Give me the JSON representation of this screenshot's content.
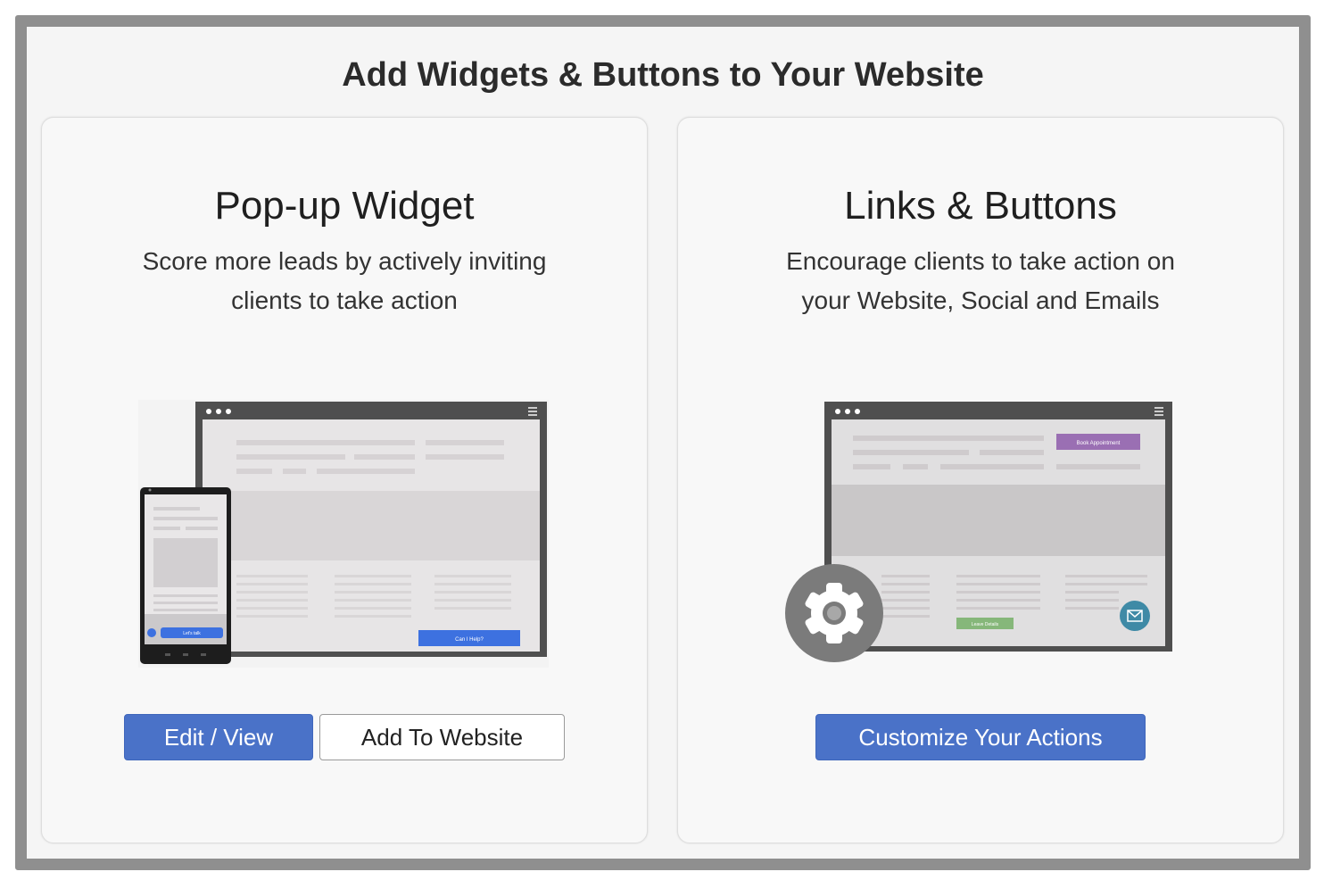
{
  "page": {
    "title": "Add Widgets & Buttons to Your Website"
  },
  "cards": [
    {
      "title": "Pop-up Widget",
      "description_lines": [
        "Score more leads by actively inviting",
        "clients to take action"
      ],
      "buttons": {
        "primary": "Edit / View",
        "secondary": "Add To Website"
      },
      "illustration": {
        "popup_button": "Can I Help?",
        "phone_button": "Let's talk"
      }
    },
    {
      "title": "Links & Buttons",
      "description_lines": [
        "Encourage clients to take action on",
        "your Website, Social and Emails"
      ],
      "buttons": {
        "primary": "Customize Your Actions"
      },
      "illustration": {
        "top_button": "Book Appointment",
        "footer_button": "Leave Details"
      }
    }
  ],
  "colors": {
    "accent": "#4a72c8",
    "purple": "#9a6fb3",
    "green": "#86b77a",
    "teal": "#3f8aa6"
  },
  "icons": [
    "gear-icon",
    "mail-icon"
  ]
}
